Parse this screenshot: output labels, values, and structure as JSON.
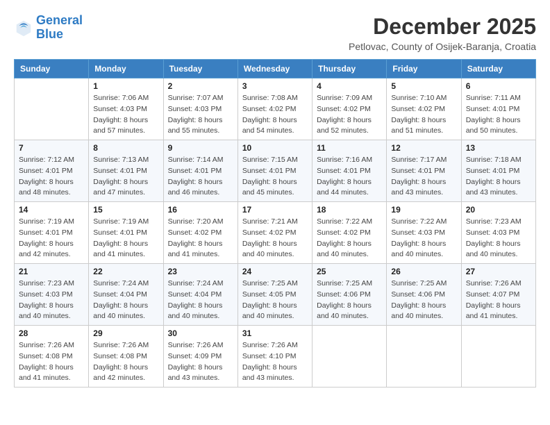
{
  "logo": {
    "line1": "General",
    "line2": "Blue"
  },
  "title": "December 2025",
  "location": "Petlovac, County of Osijek-Baranja, Croatia",
  "weekdays": [
    "Sunday",
    "Monday",
    "Tuesday",
    "Wednesday",
    "Thursday",
    "Friday",
    "Saturday"
  ],
  "weeks": [
    [
      {
        "day": null,
        "info": null
      },
      {
        "day": "1",
        "info": "Sunrise: 7:06 AM\nSunset: 4:03 PM\nDaylight: 8 hours\nand 57 minutes."
      },
      {
        "day": "2",
        "info": "Sunrise: 7:07 AM\nSunset: 4:03 PM\nDaylight: 8 hours\nand 55 minutes."
      },
      {
        "day": "3",
        "info": "Sunrise: 7:08 AM\nSunset: 4:02 PM\nDaylight: 8 hours\nand 54 minutes."
      },
      {
        "day": "4",
        "info": "Sunrise: 7:09 AM\nSunset: 4:02 PM\nDaylight: 8 hours\nand 52 minutes."
      },
      {
        "day": "5",
        "info": "Sunrise: 7:10 AM\nSunset: 4:02 PM\nDaylight: 8 hours\nand 51 minutes."
      },
      {
        "day": "6",
        "info": "Sunrise: 7:11 AM\nSunset: 4:01 PM\nDaylight: 8 hours\nand 50 minutes."
      }
    ],
    [
      {
        "day": "7",
        "info": "Sunrise: 7:12 AM\nSunset: 4:01 PM\nDaylight: 8 hours\nand 48 minutes."
      },
      {
        "day": "8",
        "info": "Sunrise: 7:13 AM\nSunset: 4:01 PM\nDaylight: 8 hours\nand 47 minutes."
      },
      {
        "day": "9",
        "info": "Sunrise: 7:14 AM\nSunset: 4:01 PM\nDaylight: 8 hours\nand 46 minutes."
      },
      {
        "day": "10",
        "info": "Sunrise: 7:15 AM\nSunset: 4:01 PM\nDaylight: 8 hours\nand 45 minutes."
      },
      {
        "day": "11",
        "info": "Sunrise: 7:16 AM\nSunset: 4:01 PM\nDaylight: 8 hours\nand 44 minutes."
      },
      {
        "day": "12",
        "info": "Sunrise: 7:17 AM\nSunset: 4:01 PM\nDaylight: 8 hours\nand 43 minutes."
      },
      {
        "day": "13",
        "info": "Sunrise: 7:18 AM\nSunset: 4:01 PM\nDaylight: 8 hours\nand 43 minutes."
      }
    ],
    [
      {
        "day": "14",
        "info": "Sunrise: 7:19 AM\nSunset: 4:01 PM\nDaylight: 8 hours\nand 42 minutes."
      },
      {
        "day": "15",
        "info": "Sunrise: 7:19 AM\nSunset: 4:01 PM\nDaylight: 8 hours\nand 41 minutes."
      },
      {
        "day": "16",
        "info": "Sunrise: 7:20 AM\nSunset: 4:02 PM\nDaylight: 8 hours\nand 41 minutes."
      },
      {
        "day": "17",
        "info": "Sunrise: 7:21 AM\nSunset: 4:02 PM\nDaylight: 8 hours\nand 40 minutes."
      },
      {
        "day": "18",
        "info": "Sunrise: 7:22 AM\nSunset: 4:02 PM\nDaylight: 8 hours\nand 40 minutes."
      },
      {
        "day": "19",
        "info": "Sunrise: 7:22 AM\nSunset: 4:03 PM\nDaylight: 8 hours\nand 40 minutes."
      },
      {
        "day": "20",
        "info": "Sunrise: 7:23 AM\nSunset: 4:03 PM\nDaylight: 8 hours\nand 40 minutes."
      }
    ],
    [
      {
        "day": "21",
        "info": "Sunrise: 7:23 AM\nSunset: 4:03 PM\nDaylight: 8 hours\nand 40 minutes."
      },
      {
        "day": "22",
        "info": "Sunrise: 7:24 AM\nSunset: 4:04 PM\nDaylight: 8 hours\nand 40 minutes."
      },
      {
        "day": "23",
        "info": "Sunrise: 7:24 AM\nSunset: 4:04 PM\nDaylight: 8 hours\nand 40 minutes."
      },
      {
        "day": "24",
        "info": "Sunrise: 7:25 AM\nSunset: 4:05 PM\nDaylight: 8 hours\nand 40 minutes."
      },
      {
        "day": "25",
        "info": "Sunrise: 7:25 AM\nSunset: 4:06 PM\nDaylight: 8 hours\nand 40 minutes."
      },
      {
        "day": "26",
        "info": "Sunrise: 7:25 AM\nSunset: 4:06 PM\nDaylight: 8 hours\nand 40 minutes."
      },
      {
        "day": "27",
        "info": "Sunrise: 7:26 AM\nSunset: 4:07 PM\nDaylight: 8 hours\nand 41 minutes."
      }
    ],
    [
      {
        "day": "28",
        "info": "Sunrise: 7:26 AM\nSunset: 4:08 PM\nDaylight: 8 hours\nand 41 minutes."
      },
      {
        "day": "29",
        "info": "Sunrise: 7:26 AM\nSunset: 4:08 PM\nDaylight: 8 hours\nand 42 minutes."
      },
      {
        "day": "30",
        "info": "Sunrise: 7:26 AM\nSunset: 4:09 PM\nDaylight: 8 hours\nand 43 minutes."
      },
      {
        "day": "31",
        "info": "Sunrise: 7:26 AM\nSunset: 4:10 PM\nDaylight: 8 hours\nand 43 minutes."
      },
      {
        "day": null,
        "info": null
      },
      {
        "day": null,
        "info": null
      },
      {
        "day": null,
        "info": null
      }
    ]
  ]
}
